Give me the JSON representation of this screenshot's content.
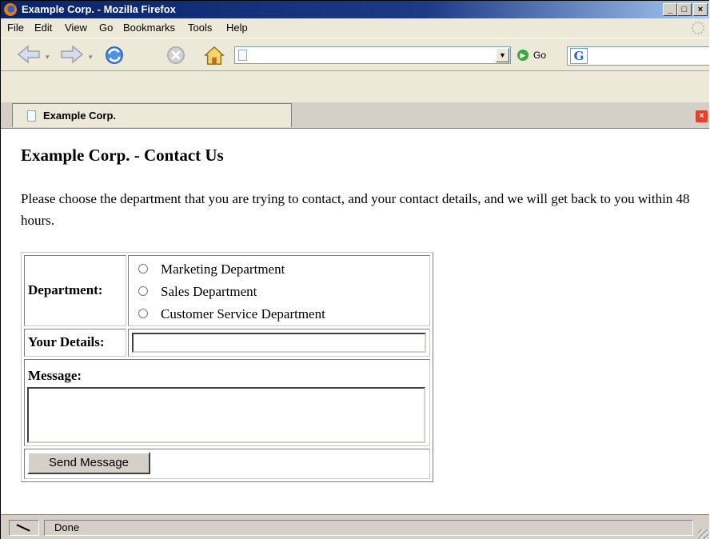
{
  "window": {
    "title": "Example Corp. - Mozilla Firefox",
    "controls": {
      "minimize": "_",
      "maximize": "□",
      "close": "×"
    }
  },
  "menu": {
    "items": [
      "File",
      "Edit",
      "View",
      "Go",
      "Bookmarks",
      "Tools",
      "Help"
    ]
  },
  "toolbar": {
    "url_value": "",
    "go_label": "Go",
    "search_engine_letter": "G",
    "search_value": "",
    "icons": [
      "back-icon",
      "forward-icon",
      "reload-icon",
      "stop-icon",
      "home-icon"
    ]
  },
  "tabs": [
    {
      "label": "Example Corp."
    }
  ],
  "page": {
    "heading": "Example Corp. - Contact Us",
    "intro": "Please choose the department that you are trying to contact, and your contact details, and we will get back to you within 48 hours.",
    "form": {
      "department_label": "Department:",
      "departments": [
        "Marketing Department",
        "Sales Department",
        "Customer Service Department"
      ],
      "details_label": "Your Details:",
      "details_value": "",
      "message_label": "Message:",
      "message_value": "",
      "submit_label": "Send Message"
    }
  },
  "status": {
    "text": "Done"
  },
  "colors": {
    "titlebar": "#0a246a",
    "chrome": "#ece9d8",
    "tab_close": "#e0422c",
    "go_green": "#3ea83e"
  }
}
